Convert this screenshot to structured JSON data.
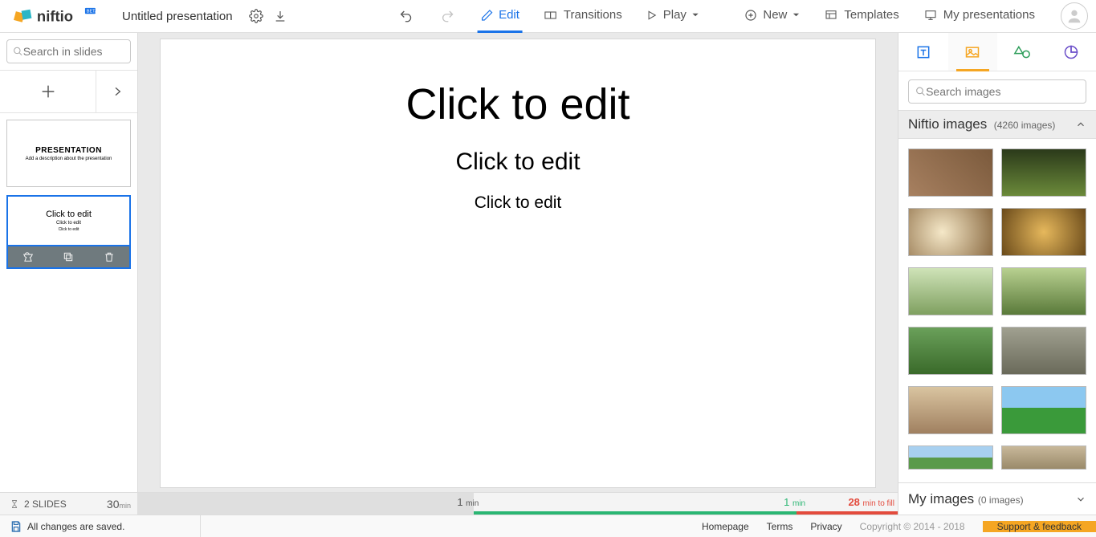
{
  "app": {
    "title": "Untitled presentation"
  },
  "topTabs": {
    "edit": "Edit",
    "transitions": "Transitions",
    "play": "Play"
  },
  "topRight": {
    "new": "New",
    "templates": "Templates",
    "myPresentations": "My presentations"
  },
  "left": {
    "searchPlaceholder": "Search in slides",
    "thumbs": [
      {
        "title": "PRESENTATION",
        "subtitle": "Add a description about the presentation"
      },
      {
        "title": "Click to edit",
        "subtitle": "Click to edit",
        "line3": "Click to edit"
      }
    ]
  },
  "canvas": {
    "title": "Click to edit",
    "subtitle": "Click to edit",
    "body": "Click to edit"
  },
  "right": {
    "searchPlaceholder": "Search images",
    "niftio": {
      "label": "Niftio images",
      "count": "(4260 images)"
    },
    "myImages": {
      "label": "My images",
      "count": "(0 images)"
    }
  },
  "status": {
    "slidesLabel": "2 SLIDES",
    "thirty": "30",
    "min": "min",
    "one": "1",
    "oneMin": "min",
    "fill": "28",
    "fillLabel": "min to fill"
  },
  "footer": {
    "saved": "All changes are saved.",
    "links": {
      "home": "Homepage",
      "terms": "Terms",
      "privacy": "Privacy"
    },
    "copy": "Copyright © 2014 - 2018",
    "support": "Support & feedback"
  }
}
